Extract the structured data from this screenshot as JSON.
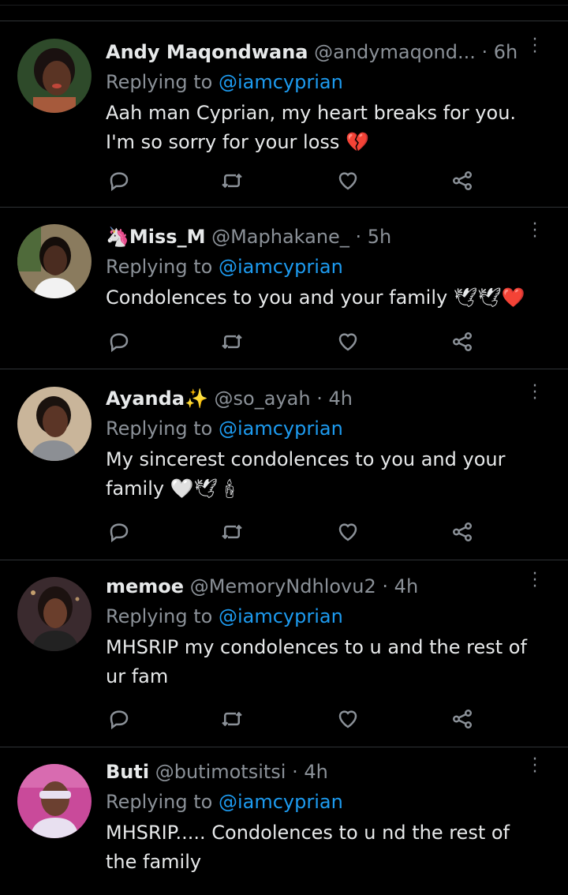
{
  "tweets": [
    {
      "name": "Andy Maqondwana",
      "handle": "@andymaqond...",
      "dot": "·",
      "time": "6h",
      "replying_prefix": "Replying to ",
      "replying_to": "@iamcyprian",
      "text_lines": [
        "Aah man Cyprian, my heart breaks for you.",
        "I'm so sorry for your loss 💔"
      ],
      "avatar_colors": {
        "bg": "#2e4a2a",
        "skin": "#5a3424",
        "hair": "#1a1110",
        "shirt": "#a65a3c"
      }
    },
    {
      "name": "🦄Miss_M",
      "handle": "@Maphakane_",
      "dot": "·",
      "time": "5h",
      "replying_prefix": "Replying to ",
      "replying_to": "@iamcyprian",
      "text_lines": [
        "Condolences to you and your family 🕊🕊❤️"
      ],
      "avatar_colors": {
        "bg": "#8a7b5e",
        "skin": "#4a2c20",
        "hair": "#140d0a",
        "shirt": "#f2f2f2"
      }
    },
    {
      "name": "Ayanda✨",
      "handle": "@so_ayah",
      "dot": "·",
      "time": "4h",
      "replying_prefix": "Replying to ",
      "replying_to": "@iamcyprian",
      "text_lines": [
        "My sincerest condolences to you and your",
        "family 🤍🕊🕯"
      ],
      "avatar_colors": {
        "bg": "#c9b59a",
        "skin": "#5b3526",
        "hair": "#1a120e",
        "shirt": "#8c8f94"
      }
    },
    {
      "name": "memoe",
      "handle": "@MemoryNdhlovu2",
      "dot": "·",
      "time": "4h",
      "replying_prefix": "Replying to ",
      "replying_to": "@iamcyprian",
      "text_lines": [
        "MHSRIP my condolences to u and the rest of",
        "ur fam"
      ],
      "avatar_colors": {
        "bg": "#3a2a2e",
        "skin": "#6a3e2c",
        "hair": "#1c1210",
        "shirt": "#222"
      }
    },
    {
      "name": "Buti",
      "handle": "@butimotsitsi",
      "dot": "·",
      "time": "4h",
      "replying_prefix": "Replying to ",
      "replying_to": "@iamcyprian",
      "text_lines": [
        "MHSRIP..... Condolences to u nd the rest of",
        "the family"
      ],
      "avatar_colors": {
        "bg": "#c94a9a",
        "skin": "#6b4030",
        "hair": "#b8a8c8",
        "shirt": "#e8e0f0"
      }
    }
  ],
  "icons": {
    "reply": "reply-icon",
    "retweet": "retweet-icon",
    "like": "heart-icon",
    "share": "share-icon",
    "more": "more-icon"
  }
}
